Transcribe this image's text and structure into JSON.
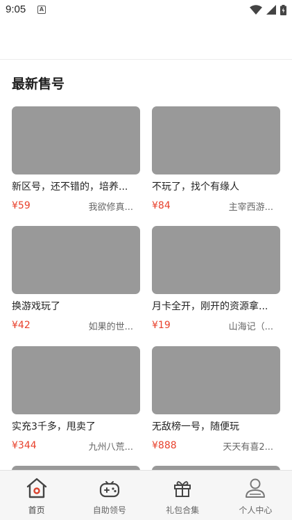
{
  "status": {
    "time": "9:05",
    "a_badge": "A"
  },
  "section": {
    "title": "最新售号"
  },
  "items": [
    {
      "title": "新区号，还不错的，培养...",
      "price": "¥59",
      "seller": "我欲修真..."
    },
    {
      "title": "不玩了，找个有缘人",
      "price": "¥84",
      "seller": "主宰西游..."
    },
    {
      "title": "换游戏玩了",
      "price": "¥42",
      "seller": "如果的世..."
    },
    {
      "title": "月卡全开，刚开的资源拿...",
      "price": "¥19",
      "seller": "山海记（..."
    },
    {
      "title": "实充3千多，甩卖了",
      "price": "¥344",
      "seller": "九州八荒..."
    },
    {
      "title": "无敌榜一号，随便玩",
      "price": "¥888",
      "seller": "天天有喜2..."
    }
  ],
  "tabs": [
    {
      "label": "首页",
      "icon": "home-icon",
      "active": true
    },
    {
      "label": "自助领号",
      "icon": "gamepad-icon",
      "active": false
    },
    {
      "label": "礼包合集",
      "icon": "gift-icon",
      "active": false
    },
    {
      "label": "个人中心",
      "icon": "user-icon",
      "active": false
    }
  ],
  "colors": {
    "price": "#e8412c",
    "placeholder": "#999999",
    "accent_red": "#d9432f"
  }
}
